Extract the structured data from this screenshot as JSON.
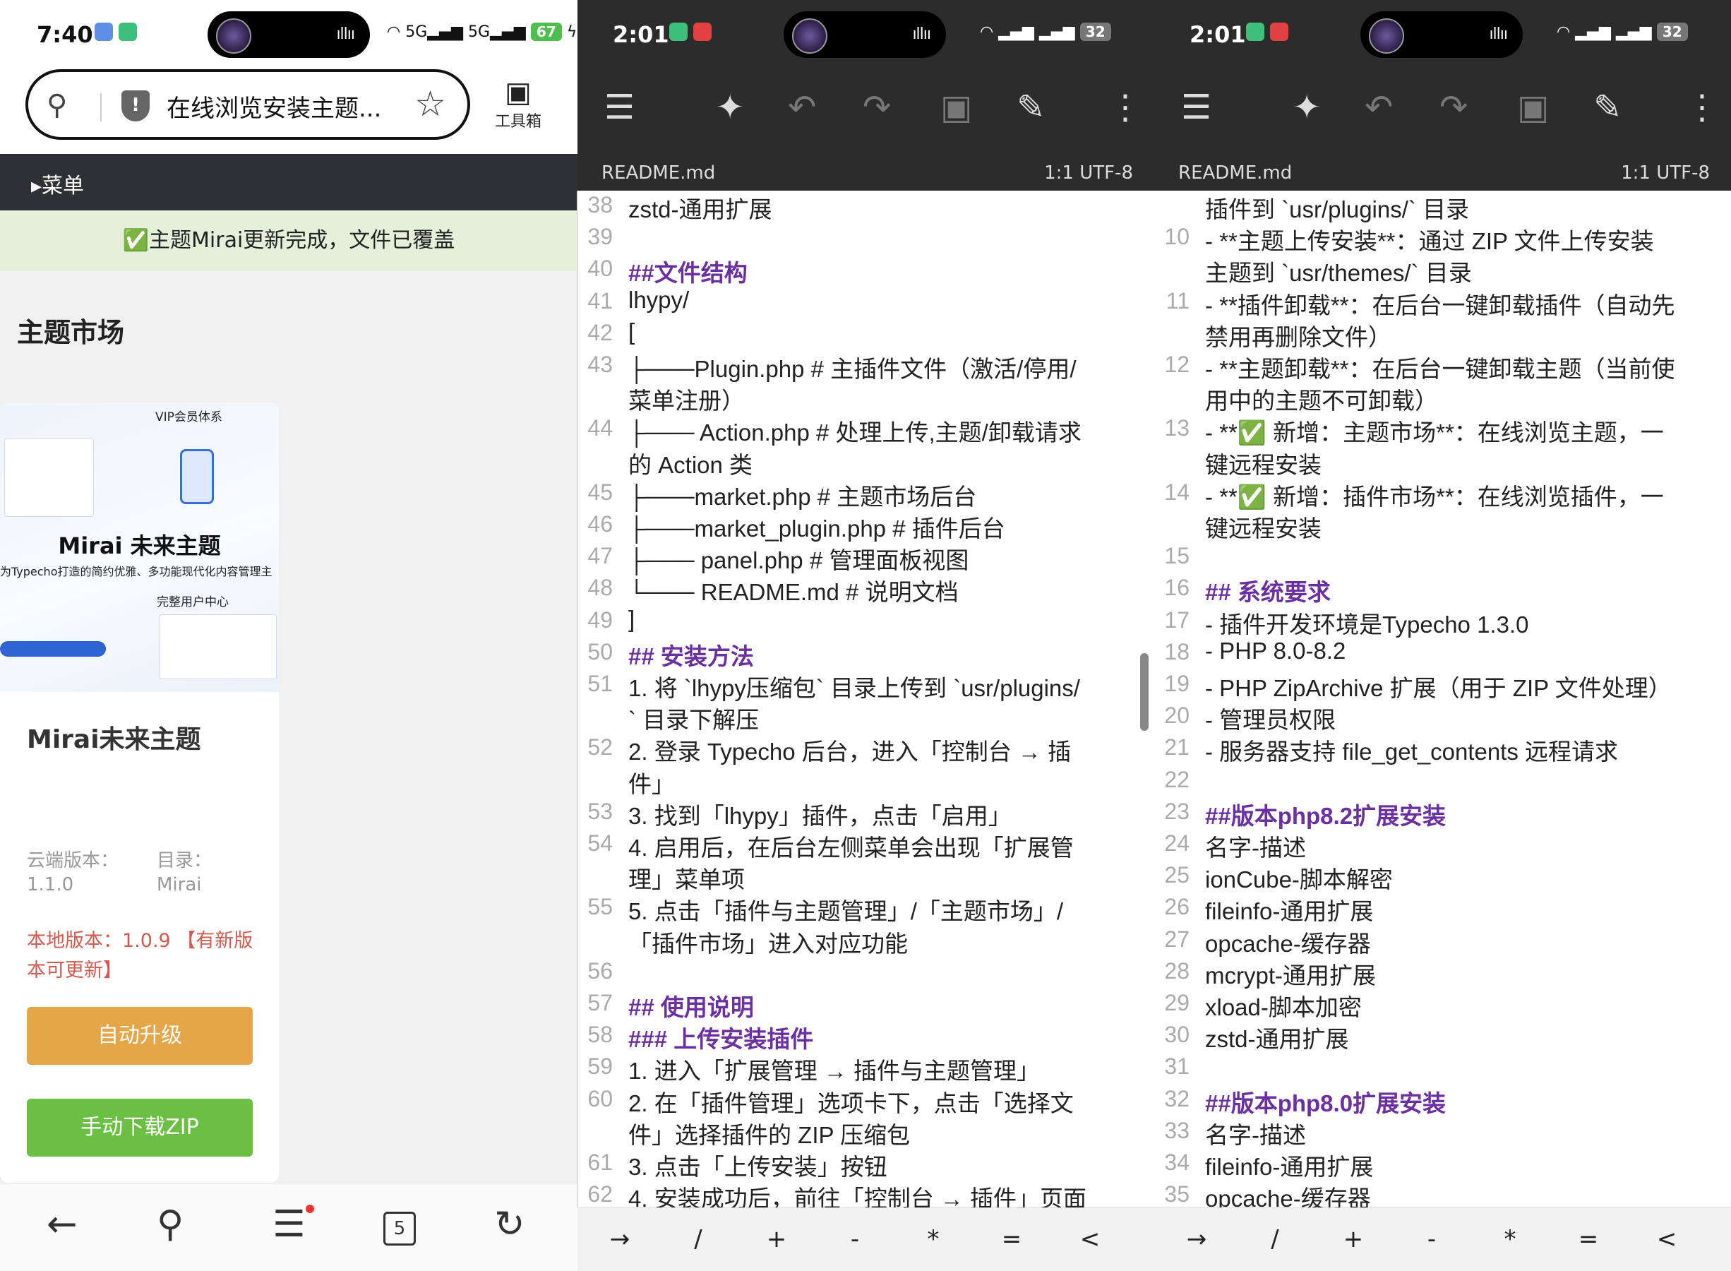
{
  "browser": {
    "status": {
      "time": "7:40",
      "signal1": "5G",
      "signal2": "5G",
      "battery": "67"
    },
    "url_title": "在线浏览安装主题...",
    "toolbox_label": "工具箱",
    "menu_label": "▸菜单",
    "notice": "✅主题Mirai更新完成，文件已覆盖",
    "section_title": "主题市场",
    "card": {
      "thumb_vip": "VIP会员体系",
      "thumb_brand": "Mirai 未来主题",
      "thumb_tagline": "为Typecho打造的简约优雅、多功能现代化内容管理主",
      "thumb_ucenter": "完整用户中心",
      "name": "Mirai未来主题",
      "cloud_label": "云端版本：",
      "cloud_value": "1.1.0",
      "dir_label": "目录：",
      "dir_value": "Mirai",
      "local_version": "本地版本：1.0.9 【有新版本可更新】",
      "btn_upgrade": "自动升级",
      "btn_download": "手动下载ZIP"
    },
    "nav": {
      "tabs_count": "5"
    }
  },
  "editor_left": {
    "status": {
      "time": "2:01",
      "battery": "32"
    },
    "file_name": "README.md",
    "position": "1:1",
    "encoding": "UTF-8",
    "lines": [
      {
        "n": "38",
        "t": "zstd-通用扩展",
        "k": "plain"
      },
      {
        "n": "39",
        "t": "",
        "k": "plain"
      },
      {
        "n": "40",
        "t": "##文件结构",
        "k": "hd"
      },
      {
        "n": "41",
        "t": "lhypy/",
        "k": "plain"
      },
      {
        "n": "42",
        "t": "[",
        "k": "plain"
      },
      {
        "n": "43",
        "t": "├───Plugin.php # 主插件文件（激活/停用/",
        "k": "plain"
      },
      {
        "n": "",
        "t": " 菜单注册）",
        "k": "plain"
      },
      {
        "n": "44",
        "t": "├─── Action.php # 处理上传,主题/卸载请求",
        "k": "plain"
      },
      {
        "n": "",
        "t": " 的 Action 类",
        "k": "plain"
      },
      {
        "n": "45",
        "t": "├───market.php # 主题市场后台",
        "k": "plain"
      },
      {
        "n": "46",
        "t": "├───market_plugin.php # 插件后台",
        "k": "plain"
      },
      {
        "n": "47",
        "t": "├─── panel.php # 管理面板视图",
        "k": "plain"
      },
      {
        "n": "48",
        "t": "└─── README.md # 说明文档",
        "k": "plain"
      },
      {
        "n": "49",
        "t": "]",
        "k": "plain"
      },
      {
        "n": "50",
        "t": "## 安装方法",
        "k": "hd"
      },
      {
        "n": "51",
        "t": "1. 将 `lhypy压缩包` 目录上传到 `usr/plugins/",
        "k": "plain"
      },
      {
        "n": "",
        "t": "` 目录下解压",
        "k": "plain"
      },
      {
        "n": "52",
        "t": "2. 登录 Typecho 后台，进入「控制台 → 插",
        "k": "plain"
      },
      {
        "n": "",
        "t": " 件」",
        "k": "plain"
      },
      {
        "n": "53",
        "t": "3. 找到「lhypy」插件，点击「启用」",
        "k": "plain"
      },
      {
        "n": "54",
        "t": "4. 启用后，在后台左侧菜单会出现「扩展管",
        "k": "plain"
      },
      {
        "n": "",
        "t": " 理」菜单项",
        "k": "plain"
      },
      {
        "n": "55",
        "t": "5. 点击「插件与主题管理」/「主题市场」/",
        "k": "plain"
      },
      {
        "n": "",
        "t": "「插件市场」进入对应功能",
        "k": "plain"
      },
      {
        "n": "56",
        "t": "",
        "k": "plain"
      },
      {
        "n": "57",
        "t": "## 使用说明",
        "k": "hd"
      },
      {
        "n": "58",
        "t": "### 上传安装插件",
        "k": "hd"
      },
      {
        "n": "59",
        "t": "1. 进入「扩展管理 → 插件与主题管理」",
        "k": "plain"
      },
      {
        "n": "60",
        "t": "2. 在「插件管理」选项卡下，点击「选择文",
        "k": "plain"
      },
      {
        "n": "",
        "t": " 件」选择插件的 ZIP 压缩包",
        "k": "plain"
      },
      {
        "n": "61",
        "t": "3. 点击「上传安装」按钮",
        "k": "plain"
      },
      {
        "n": "62",
        "t": "4. 安装成功后，前往「控制台 → 插件」页面",
        "k": "plain"
      }
    ]
  },
  "editor_right": {
    "status": {
      "time": "2:01",
      "battery": "32"
    },
    "file_name": "README.md",
    "position": "1:1",
    "encoding": "UTF-8",
    "lines": [
      {
        "n": "",
        "t": " 插件到 `usr/plugins/` 目录",
        "k": "plain"
      },
      {
        "n": "10",
        "t": "- **主题上传安装**：通过 ZIP 文件上传安装",
        "k": "plain"
      },
      {
        "n": "",
        "t": " 主题到 `usr/themes/` 目录",
        "k": "plain"
      },
      {
        "n": "11",
        "t": "- **插件卸载**：在后台一键卸载插件（自动先",
        "k": "plain"
      },
      {
        "n": "",
        "t": " 禁用再删除文件）",
        "k": "plain"
      },
      {
        "n": "12",
        "t": "- **主题卸载**：在后台一键卸载主题（当前使",
        "k": "plain"
      },
      {
        "n": "",
        "t": " 用中的主题不可卸载）",
        "k": "plain"
      },
      {
        "n": "13",
        "t": "- **✅ 新增：主题市场**：在线浏览主题，一",
        "k": "plain"
      },
      {
        "n": "",
        "t": " 键远程安装",
        "k": "plain"
      },
      {
        "n": "14",
        "t": "- **✅ 新增：插件市场**：在线浏览插件，一",
        "k": "plain"
      },
      {
        "n": "",
        "t": " 键远程安装",
        "k": "plain"
      },
      {
        "n": "15",
        "t": "",
        "k": "plain"
      },
      {
        "n": "16",
        "t": "## 系统要求",
        "k": "hd"
      },
      {
        "n": "17",
        "t": "- 插件开发环境是Typecho 1.3.0",
        "k": "plain"
      },
      {
        "n": "18",
        "t": "- PHP 8.0-8.2",
        "k": "plain"
      },
      {
        "n": "19",
        "t": "- PHP ZipArchive 扩展（用于 ZIP 文件处理）",
        "k": "plain"
      },
      {
        "n": "20",
        "t": "- 管理员权限",
        "k": "plain"
      },
      {
        "n": "21",
        "t": "- 服务器支持 file_get_contents 远程请求",
        "k": "plain"
      },
      {
        "n": "22",
        "t": "",
        "k": "plain"
      },
      {
        "n": "23",
        "t": "##版本php8.2扩展安装",
        "k": "hd"
      },
      {
        "n": "24",
        "t": "名字-描述",
        "k": "plain"
      },
      {
        "n": "25",
        "t": "ionCube-脚本解密",
        "k": "plain"
      },
      {
        "n": "26",
        "t": "fileinfo-通用扩展",
        "k": "plain"
      },
      {
        "n": "27",
        "t": "opcache-缓存器",
        "k": "plain"
      },
      {
        "n": "28",
        "t": "mcrypt-通用扩展",
        "k": "plain"
      },
      {
        "n": "29",
        "t": "xload-脚本加密",
        "k": "plain"
      },
      {
        "n": "30",
        "t": "zstd-通用扩展",
        "k": "plain"
      },
      {
        "n": "31",
        "t": "",
        "k": "plain"
      },
      {
        "n": "32",
        "t": "##版本php8.0扩展安装",
        "k": "hd"
      },
      {
        "n": "33",
        "t": "名字-描述",
        "k": "plain"
      },
      {
        "n": "34",
        "t": "fileinfo-通用扩展",
        "k": "plain"
      },
      {
        "n": "35",
        "t": "opcache-缓存器",
        "k": "plain"
      }
    ]
  },
  "keys": [
    "→",
    "/",
    "+",
    "-",
    "*",
    "=",
    "<"
  ],
  "icons": {
    "menu": "☰",
    "pin": "📌",
    "undo": "↶",
    "redo": "↷",
    "save": "💾",
    "edit": "✎",
    "more": "⋮",
    "search": "⚲",
    "star": "☆",
    "back": "←",
    "reload": "↻",
    "toolbox": "🧰"
  },
  "colors": {
    "heading": "#6a2fa0",
    "link": "#2a4fb0",
    "upgrade": "#e5a64a",
    "download": "#6bbf45",
    "notice_bg": "#e4f0da",
    "local_version": "#d2594f"
  }
}
